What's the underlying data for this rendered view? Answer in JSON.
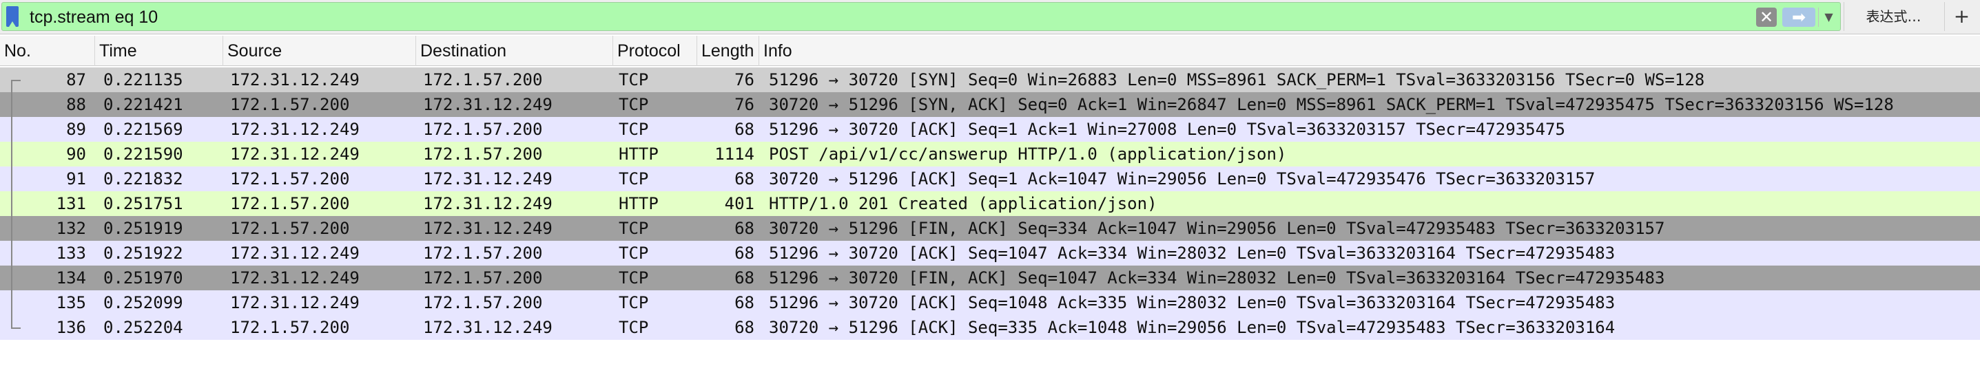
{
  "filter": {
    "value": "tcp.stream eq 10",
    "clear_icon": "clear-icon",
    "apply_icon": "apply-arrow-icon",
    "dropdown_icon": "chevron-down-icon",
    "expression_label": "表达式…",
    "add_label": "+"
  },
  "columns": [
    "No.",
    "Time",
    "Source",
    "Destination",
    "Protocol",
    "Length",
    "Info"
  ],
  "colors": {
    "tcp": "#e7e6ff",
    "http": "#e4ffc7",
    "selected": "#cfcfcf",
    "fin_syn": "#a0a0a0"
  },
  "rows": [
    {
      "no": "87",
      "time": "0.221135",
      "src": "172.31.12.249",
      "dst": "172.1.57.200",
      "proto": "TCP",
      "len": "76",
      "info": "51296 → 30720 [SYN] Seq=0 Win=26883 Len=0 MSS=8961 SACK_PERM=1 TSval=3633203156 TSecr=0 WS=128",
      "style": "selected"
    },
    {
      "no": "88",
      "time": "0.221421",
      "src": "172.1.57.200",
      "dst": "172.31.12.249",
      "proto": "TCP",
      "len": "76",
      "info": "30720 → 51296 [SYN, ACK] Seq=0 Ack=1 Win=26847 Len=0 MSS=8961 SACK_PERM=1 TSval=472935475 TSecr=3633203156 WS=128",
      "style": "fin_syn"
    },
    {
      "no": "89",
      "time": "0.221569",
      "src": "172.31.12.249",
      "dst": "172.1.57.200",
      "proto": "TCP",
      "len": "68",
      "info": "51296 → 30720 [ACK] Seq=1 Ack=1 Win=27008 Len=0 TSval=3633203157 TSecr=472935475",
      "style": "tcp"
    },
    {
      "no": "90",
      "time": "0.221590",
      "src": "172.31.12.249",
      "dst": "172.1.57.200",
      "proto": "HTTP",
      "len": "1114",
      "info": "POST /api/v1/cc/answerup HTTP/1.0  (application/json)",
      "style": "http"
    },
    {
      "no": "91",
      "time": "0.221832",
      "src": "172.1.57.200",
      "dst": "172.31.12.249",
      "proto": "TCP",
      "len": "68",
      "info": "30720 → 51296 [ACK] Seq=1 Ack=1047 Win=29056 Len=0 TSval=472935476 TSecr=3633203157",
      "style": "tcp"
    },
    {
      "no": "131",
      "time": "0.251751",
      "src": "172.1.57.200",
      "dst": "172.31.12.249",
      "proto": "HTTP",
      "len": "401",
      "info": "HTTP/1.0 201 Created  (application/json)",
      "style": "http"
    },
    {
      "no": "132",
      "time": "0.251919",
      "src": "172.1.57.200",
      "dst": "172.31.12.249",
      "proto": "TCP",
      "len": "68",
      "info": "30720 → 51296 [FIN, ACK] Seq=334 Ack=1047 Win=29056 Len=0 TSval=472935483 TSecr=3633203157",
      "style": "fin_syn"
    },
    {
      "no": "133",
      "time": "0.251922",
      "src": "172.31.12.249",
      "dst": "172.1.57.200",
      "proto": "TCP",
      "len": "68",
      "info": "51296 → 30720 [ACK] Seq=1047 Ack=334 Win=28032 Len=0 TSval=3633203164 TSecr=472935483",
      "style": "tcp"
    },
    {
      "no": "134",
      "time": "0.251970",
      "src": "172.31.12.249",
      "dst": "172.1.57.200",
      "proto": "TCP",
      "len": "68",
      "info": "51296 → 30720 [FIN, ACK] Seq=1047 Ack=334 Win=28032 Len=0 TSval=3633203164 TSecr=472935483",
      "style": "fin_syn"
    },
    {
      "no": "135",
      "time": "0.252099",
      "src": "172.31.12.249",
      "dst": "172.1.57.200",
      "proto": "TCP",
      "len": "68",
      "info": "51296 → 30720 [ACK] Seq=1048 Ack=335 Win=28032 Len=0 TSval=3633203164 TSecr=472935483",
      "style": "tcp"
    },
    {
      "no": "136",
      "time": "0.252204",
      "src": "172.1.57.200",
      "dst": "172.31.12.249",
      "proto": "TCP",
      "len": "68",
      "info": "30720 → 51296 [ACK] Seq=335 Ack=1048 Win=29056 Len=0 TSval=472935483 TSecr=3633203164",
      "style": "tcp"
    }
  ]
}
